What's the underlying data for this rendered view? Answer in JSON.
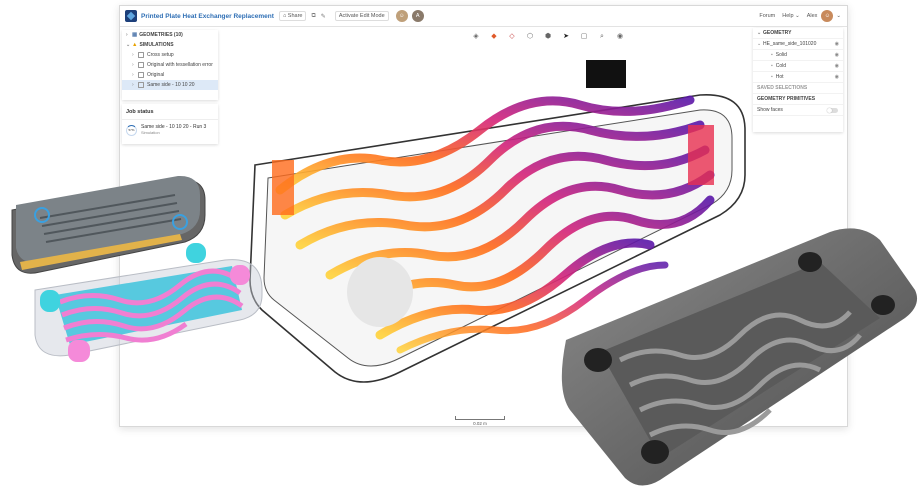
{
  "topbar": {
    "project_title": "Printed Plate Heat Exchanger Replacement",
    "share_label": "Share",
    "activate_edit_label": "Activate Edit Mode",
    "avatar_letter": "A",
    "forum_label": "Forum",
    "help_label": "Help",
    "user_label": "Alex"
  },
  "simulation_tree": {
    "geometries_label": "GEOMETRIES (10)",
    "simulations_label": "SIMULATIONS",
    "items": [
      {
        "label": "Cross setup"
      },
      {
        "label": "Original with tessellation error"
      },
      {
        "label": "Original"
      },
      {
        "label": "Same side - 10 10 20"
      }
    ]
  },
  "job_status": {
    "title": "Job status",
    "progress": "57%",
    "job_name": "Same side - 10 10 20 - Run 3",
    "job_type": "Simulation"
  },
  "geometry_panel": {
    "title": "GEOMETRY",
    "file": "HE_same_side_101020",
    "parts": [
      "Solid",
      "Cold",
      "Hot"
    ],
    "saved_selections": "SAVED SELECTIONS",
    "primitives": "GEOMETRY PRIMITIVES",
    "show_faces": "Show faces"
  },
  "viewport": {
    "scale_label": "0.02 m"
  },
  "colors": {
    "accent": "#2f6fb5",
    "hot": "#ff7a1a",
    "cold": "#5a17a8",
    "cyan_part": "#3fd3df",
    "pink_part": "#f58ad9"
  }
}
